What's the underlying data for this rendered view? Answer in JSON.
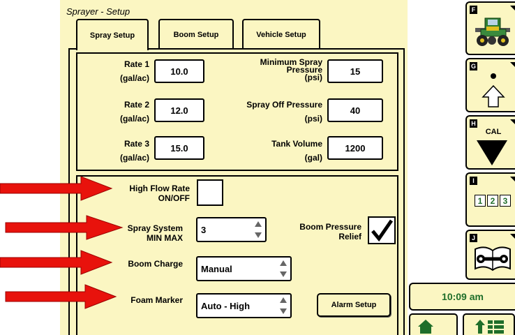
{
  "screen": {
    "title": "Sprayer - Setup"
  },
  "tabs": [
    {
      "label": "Spray Setup",
      "active": true
    },
    {
      "label": "Boom Setup",
      "active": false
    },
    {
      "label": "Vehicle Setup",
      "active": false
    }
  ],
  "spray_setup": {
    "rate1": {
      "label": "Rate 1",
      "unit": "(gal/ac)",
      "value": "10.0"
    },
    "rate2": {
      "label": "Rate 2",
      "unit": "(gal/ac)",
      "value": "12.0"
    },
    "rate3": {
      "label": "Rate 3",
      "unit": "(gal/ac)",
      "value": "15.0"
    },
    "min_spray_pressure": {
      "label_line1": "Minimum Spray",
      "label_line2": "Pressure",
      "unit": "(psi)",
      "value": "15"
    },
    "spray_off_pressure": {
      "label": "Spray Off Pressure",
      "unit": "(psi)",
      "value": "40"
    },
    "tank_volume": {
      "label": "Tank Volume",
      "unit": "(gal)",
      "value": "1200"
    }
  },
  "options": {
    "high_flow": {
      "label_line1": "High Flow Rate",
      "label_line2": "ON/OFF",
      "checked": false
    },
    "spray_system": {
      "label_line1": "Spray System",
      "label_line2": "MIN MAX",
      "value": "3"
    },
    "boom_pressure_relief": {
      "label_line1": "Boom Pressure",
      "label_line2": "Relief",
      "checked": true
    },
    "boom_charge": {
      "label": "Boom Charge",
      "value": "Manual"
    },
    "foam_marker": {
      "label": "Foam Marker",
      "value": "Auto - High"
    },
    "alarm_setup_label": "Alarm Setup"
  },
  "softkeys": [
    {
      "letter": "F",
      "icon": "sprayer-vehicle-icon"
    },
    {
      "letter": "G",
      "icon": "up-arrow-dot-icon"
    },
    {
      "letter": "H",
      "icon": "cal-down-triangle-icon",
      "text": "CAL"
    },
    {
      "letter": "I",
      "icon": "number-sequence-icon",
      "digits": [
        "1",
        "2",
        "3"
      ]
    },
    {
      "letter": "J",
      "icon": "wrench-book-icon"
    }
  ],
  "status": {
    "time": "10:09 am"
  },
  "bottom_buttons": [
    {
      "icon": "home-icon"
    },
    {
      "icon": "up-arrow-menu-icon"
    }
  ],
  "colors": {
    "panel": "#fbf6c2",
    "annotation_arrow": "#e8120c",
    "time_text": "#1f6e2a",
    "number_text": "#1f6e2a"
  }
}
